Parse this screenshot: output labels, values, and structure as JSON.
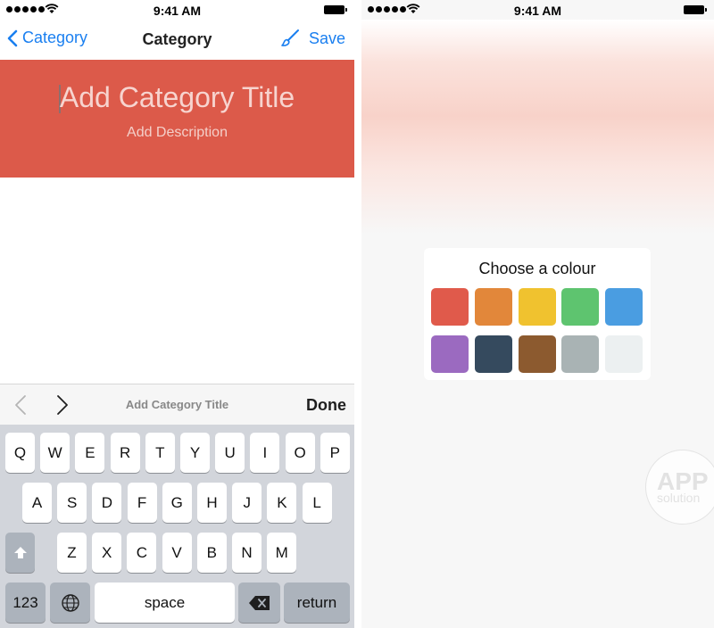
{
  "status_bar": {
    "time": "9:41 AM"
  },
  "left": {
    "nav": {
      "back_label": "Category",
      "title": "Category",
      "save_label": "Save"
    },
    "header": {
      "title_placeholder": "Add Category Title",
      "description_placeholder": "Add Description",
      "color": "#dc5a4a"
    },
    "accessory": {
      "label": "Add Category Title",
      "done_label": "Done"
    },
    "keyboard": {
      "row1": [
        "Q",
        "W",
        "E",
        "R",
        "T",
        "Y",
        "U",
        "I",
        "O",
        "P"
      ],
      "row2": [
        "A",
        "S",
        "D",
        "F",
        "G",
        "H",
        "J",
        "K",
        "L"
      ],
      "row3": [
        "Z",
        "X",
        "C",
        "V",
        "B",
        "N",
        "M"
      ],
      "numbers_label": "123",
      "space_label": "space",
      "return_label": "return"
    }
  },
  "right": {
    "picker": {
      "title": "Choose a colour",
      "colors": [
        "#e05a4b",
        "#e2873a",
        "#f0c22f",
        "#5ec46f",
        "#4a9de1",
        "#9b6ac0",
        "#354a5e",
        "#8c5a2f",
        "#a9b3b4",
        "#ecf0f1"
      ]
    },
    "watermark": {
      "line1": "APP",
      "line2": "solution"
    }
  },
  "icons": {
    "back": "chevron-left-icon",
    "save": "brush-icon",
    "prev": "chevron-left-icon",
    "next": "chevron-right-icon",
    "shift": "shift-arrow-icon",
    "globe": "globe-icon",
    "delete": "backspace-icon",
    "wifi": "wifi-icon",
    "battery": "battery-icon"
  },
  "colors": {
    "accent": "#1a7ff0",
    "keyboard_bg": "#d2d5db",
    "key_dark": "#acb3bc"
  }
}
